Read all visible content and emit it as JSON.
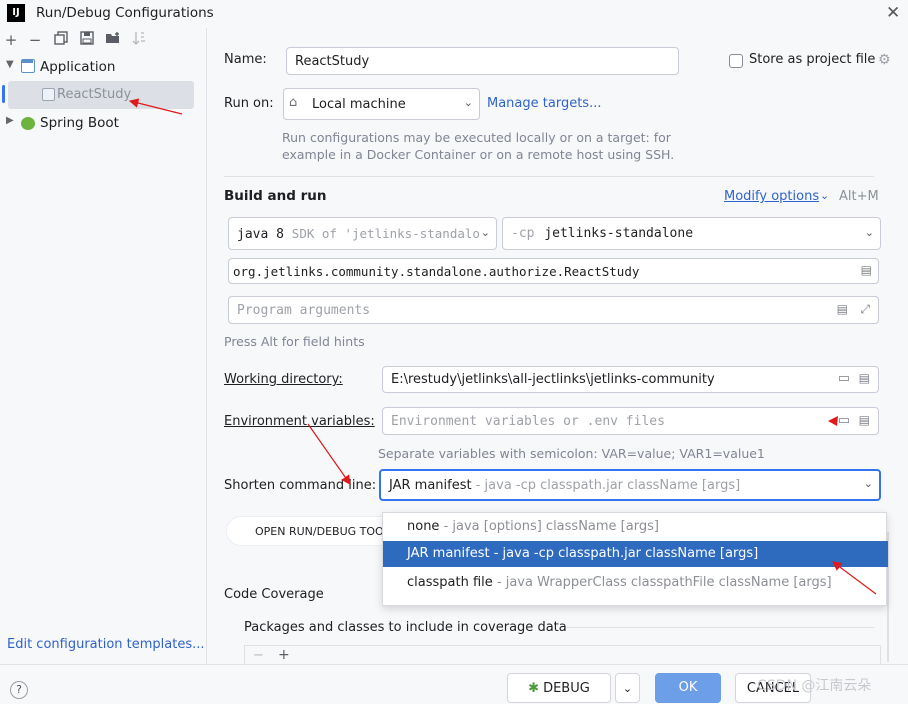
{
  "window": {
    "title": "Run/Debug Configurations",
    "logo_text": "IJ"
  },
  "sidebar": {
    "toolbar": [
      "+",
      "−"
    ],
    "tree": {
      "application_label": "Application",
      "react_study_label": "ReactStudy",
      "spring_boot_label": "Spring Boot"
    },
    "edit_templates_link": "Edit configuration templates..."
  },
  "form": {
    "name_label": "Name:",
    "name_value": "ReactStudy",
    "store_label": "Store as project file",
    "run_on_label": "Run on:",
    "run_on_value": "Local machine",
    "manage_targets": "Manage targets...",
    "run_hint_1": "Run configurations may be executed locally or on a target: for",
    "run_hint_2": "example in a Docker Container or on a remote host using SSH.",
    "build_run_heading": "Build and run",
    "modify_options": "Modify options",
    "modify_shortcut": "Alt+M",
    "jdk_value_main": "java 8",
    "jdk_value_gray": "SDK of 'jetlinks-standalo",
    "cp_prefix": "-cp",
    "cp_value": "jetlinks-standalone",
    "main_class": "org.jetlinks.community.standalone.authorize.ReactStudy",
    "program_args_placeholder": "Program arguments",
    "field_hints": "Press Alt for field hints",
    "working_dir_label": "Working directory:",
    "working_dir_value": "E:\\restudy\\jetlinks\\all-jectlinks\\jetlinks-community",
    "env_label": "Environment variables:",
    "env_placeholder": "Environment variables or .env files",
    "env_hint": "Separate variables with semicolon: VAR=value; VAR1=value1",
    "shorten_label": "Shorten command line:",
    "shorten_value_main": "JAR manifest",
    "shorten_value_gray": "- java -cp classpath.jar className [args]",
    "open_tool_button": "OPEN RUN/DEBUG TOOL",
    "coverage_heading": "Code Coverage",
    "coverage_packages": "Packages and classes to include in coverage data"
  },
  "dropdown": {
    "options": [
      {
        "main": "none",
        "gray": "- java [options] className [args]"
      },
      {
        "main": "JAR manifest",
        "gray": "- java -cp classpath.jar className [args]"
      },
      {
        "main": "classpath file",
        "gray": "- java WrapperClass classpathFile className [args]"
      }
    ]
  },
  "footer": {
    "help": "?",
    "debug_button": "DEBUG",
    "ok_button": "OK",
    "cancel_button": "CANCEL",
    "watermark": "CSDN @江南云朵"
  },
  "colors": {
    "accent": "#3574f0",
    "selection": "#2e6bbf",
    "link": "#2f63c9",
    "annotation": "#e0191c"
  }
}
